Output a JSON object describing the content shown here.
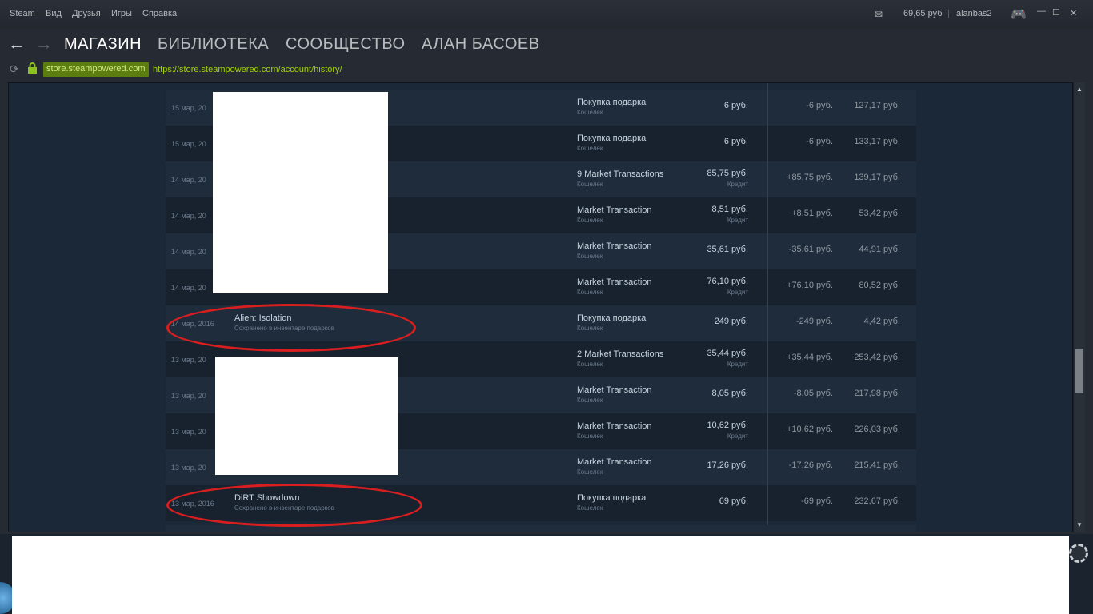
{
  "menubar": {
    "items": [
      "Steam",
      "Вид",
      "Друзья",
      "Игры",
      "Справка"
    ],
    "wallet": "69,65 руб",
    "separator": "|",
    "username": "alanbas2",
    "window_controls": {
      "minimize": "—",
      "maximize": "☐",
      "close": "✕"
    }
  },
  "nav": {
    "back": "←",
    "forward": "→",
    "tabs": [
      "МАГАЗИН",
      "БИБЛИОТЕКА",
      "СООБЩЕСТВО",
      "АЛАН БАСОЕВ"
    ],
    "active_tab": 0
  },
  "address": {
    "domain": "store.steampowered.com",
    "url": "https://store.steampowered.com/account/history/",
    "refresh_icon": "refresh-icon",
    "lock_icon": "lock-icon"
  },
  "history": {
    "rows": [
      {
        "date": "15 мар, 20",
        "item": "",
        "item_sub": "",
        "type": "Покупка подарка",
        "type_sub": "Кошелек",
        "total": "6 руб.",
        "credit": "",
        "change": "-6 руб.",
        "balance": "127,17 руб."
      },
      {
        "date": "15 мар, 20",
        "item": "",
        "item_sub": "",
        "type": "Покупка подарка",
        "type_sub": "Кошелек",
        "total": "6 руб.",
        "credit": "",
        "change": "-6 руб.",
        "balance": "133,17 руб."
      },
      {
        "date": "14 мар, 20",
        "item": "",
        "item_sub": "",
        "type": "9 Market Transactions",
        "type_sub": "Кошелек",
        "total": "85,75 руб.",
        "credit": "Кредит",
        "change": "+85,75 руб.",
        "balance": "139,17 руб."
      },
      {
        "date": "14 мар, 20",
        "item": "",
        "item_sub": "",
        "type": "Market Transaction",
        "type_sub": "Кошелек",
        "total": "8,51 руб.",
        "credit": "Кредит",
        "change": "+8,51 руб.",
        "balance": "53,42 руб."
      },
      {
        "date": "14 мар, 20",
        "item": "",
        "item_sub": "",
        "type": "Market Transaction",
        "type_sub": "Кошелек",
        "total": "35,61 руб.",
        "credit": "",
        "change": "-35,61 руб.",
        "balance": "44,91 руб."
      },
      {
        "date": "14 мар, 20",
        "item": "",
        "item_sub": "",
        "type": "Market Transaction",
        "type_sub": "Кошелек",
        "total": "76,10 руб.",
        "credit": "Кредит",
        "change": "+76,10 руб.",
        "balance": "80,52 руб."
      },
      {
        "date": "14 мар, 2016",
        "item": "Alien: Isolation",
        "item_sub": "Сохранено в инвентаре подарков",
        "type": "Покупка подарка",
        "type_sub": "Кошелек",
        "total": "249 руб.",
        "credit": "",
        "change": "-249 руб.",
        "balance": "4,42 руб."
      },
      {
        "date": "13 мар, 20",
        "item": "",
        "item_sub": "",
        "type": "2 Market Transactions",
        "type_sub": "Кошелек",
        "total": "35,44 руб.",
        "credit": "Кредит",
        "change": "+35,44 руб.",
        "balance": "253,42 руб."
      },
      {
        "date": "13 мар, 20",
        "item": "",
        "item_sub": "",
        "type": "Market Transaction",
        "type_sub": "Кошелек",
        "total": "8,05 руб.",
        "credit": "",
        "change": "-8,05 руб.",
        "balance": "217,98 руб."
      },
      {
        "date": "13 мар, 20",
        "item": "",
        "item_sub": "",
        "type": "Market Transaction",
        "type_sub": "Кошелек",
        "total": "10,62 руб.",
        "credit": "Кредит",
        "change": "+10,62 руб.",
        "balance": "226,03 руб."
      },
      {
        "date": "13 мар, 20",
        "item": "",
        "item_sub": "",
        "type": "Market Transaction",
        "type_sub": "Кошелек",
        "total": "17,26 руб.",
        "credit": "",
        "change": "-17,26 руб.",
        "balance": "215,41 руб."
      },
      {
        "date": "13 мар, 2016",
        "item": "DiRT Showdown",
        "item_sub": "Сохранено в инвентаре подарков",
        "type": "Покупка подарка",
        "type_sub": "Кошелек",
        "total": "69 руб.",
        "credit": "",
        "change": "-69 руб.",
        "balance": "232,67 руб."
      }
    ]
  },
  "colors": {
    "annotation": "#d81e1e",
    "link_green": "#a4d007",
    "background": "#1b2838"
  }
}
